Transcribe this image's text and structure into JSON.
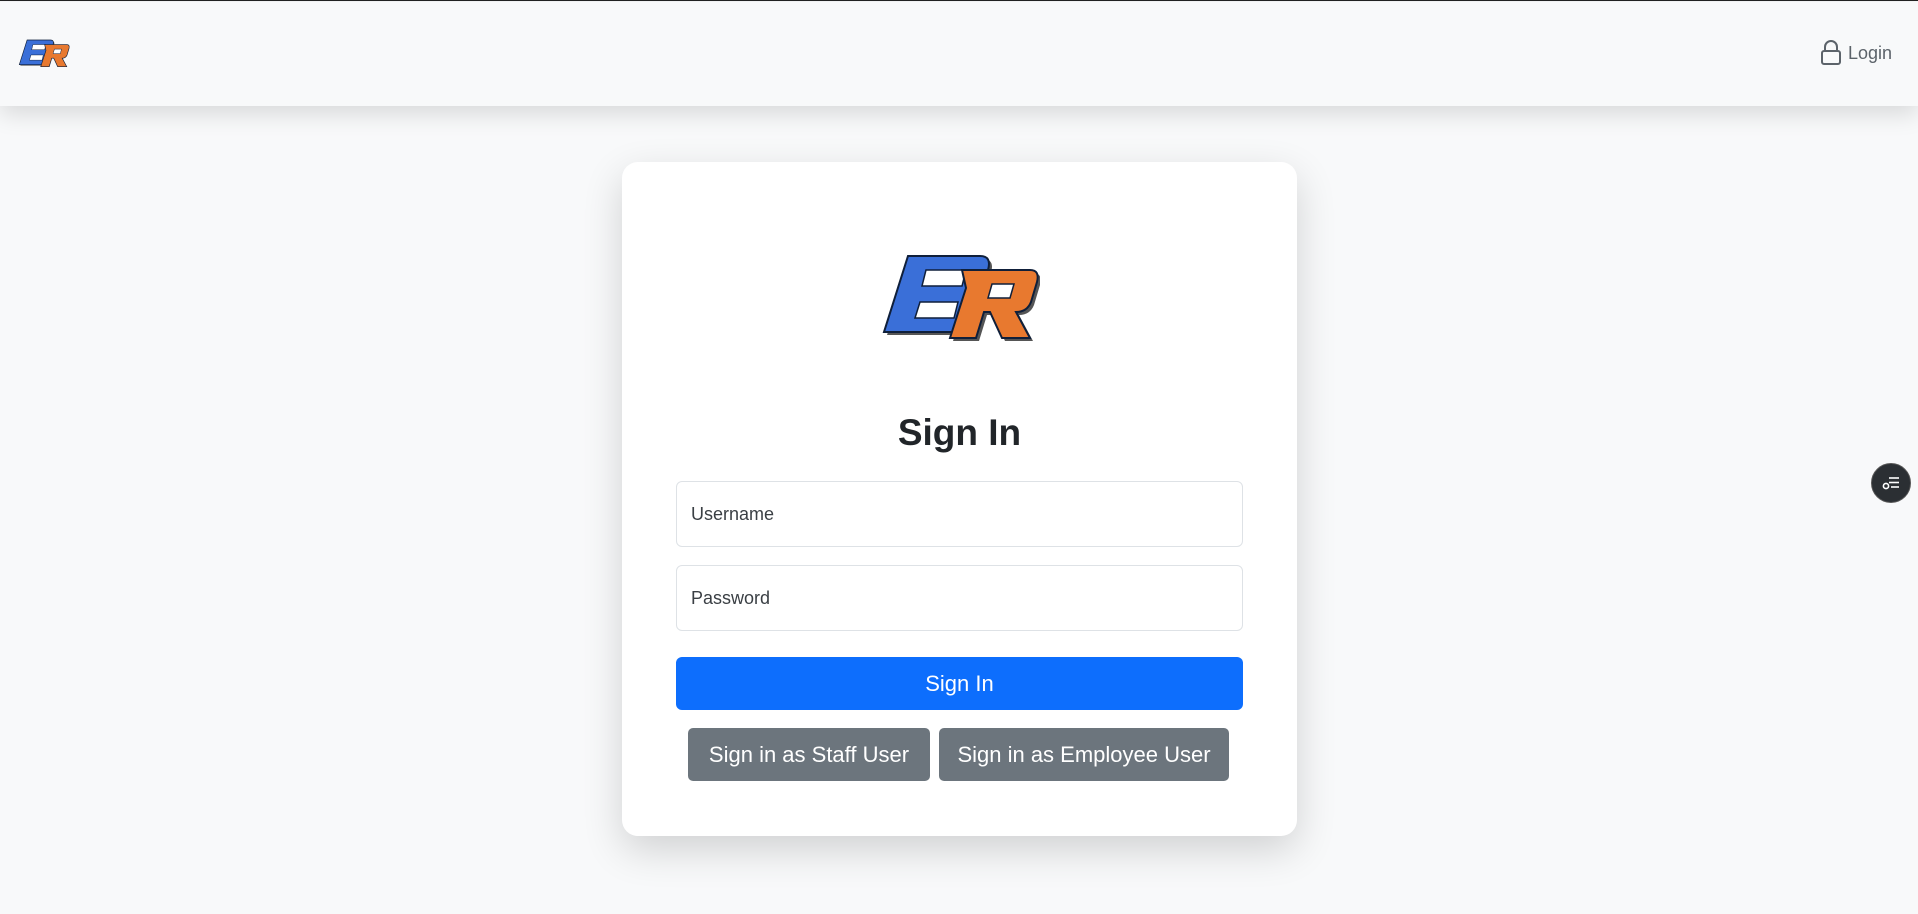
{
  "header": {
    "logo_icon": "br-logo-icon",
    "login_icon": "lock-icon",
    "login_label": "Login"
  },
  "card": {
    "logo_icon": "br-logo-icon",
    "title": "Sign In",
    "username": {
      "value": "",
      "placeholder": "Username"
    },
    "password": {
      "value": "",
      "placeholder": "Password"
    },
    "sign_in_label": "Sign In",
    "staff_label": "Sign in as Staff User",
    "employee_label": "Sign in as Employee User"
  },
  "floating": {
    "icon": "settings-list-icon"
  },
  "colors": {
    "primary": "#0d6efd",
    "secondary": "#6c757d",
    "logo_blue": "#3a6fd8",
    "logo_orange": "#e8792f"
  }
}
